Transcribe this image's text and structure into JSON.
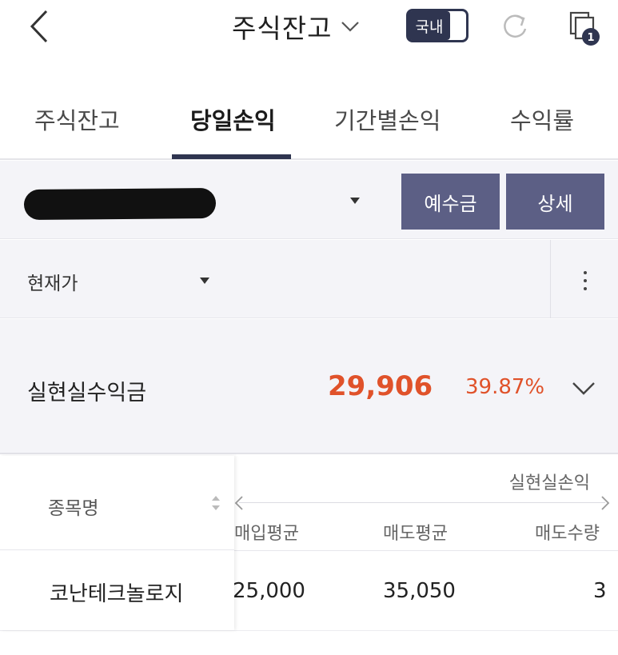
{
  "header": {
    "title": "주식잔고",
    "toggle_label": "국내",
    "copy_badge": "1",
    "icons": [
      "back-icon",
      "chevron-down-icon",
      "refresh-icon",
      "copy-icon"
    ]
  },
  "tabs": [
    {
      "label": "주식잔고",
      "active": false
    },
    {
      "label": "당일손익",
      "active": true
    },
    {
      "label": "기간별손익",
      "active": false
    },
    {
      "label": "수익률",
      "active": false
    }
  ],
  "account": {
    "buttons": {
      "deposit": "예수금",
      "detail": "상세"
    }
  },
  "price_selector": {
    "label": "현재가"
  },
  "summary": {
    "label": "실현실수익금",
    "amount": "29,906",
    "rate": "39.87%"
  },
  "table": {
    "name_header": "종목명",
    "group_header": "실현실손익",
    "columns": [
      "매입평균",
      "매도평균",
      "매도수량"
    ],
    "rows": [
      {
        "name": "코난테크놀로지",
        "buy_avg": "25,000",
        "sell_avg": "35,050",
        "sell_qty": "3"
      }
    ]
  },
  "colors": {
    "accent_navy": "#2f3550",
    "button_purple": "#5c5f85",
    "profit_red": "#e0522a"
  }
}
